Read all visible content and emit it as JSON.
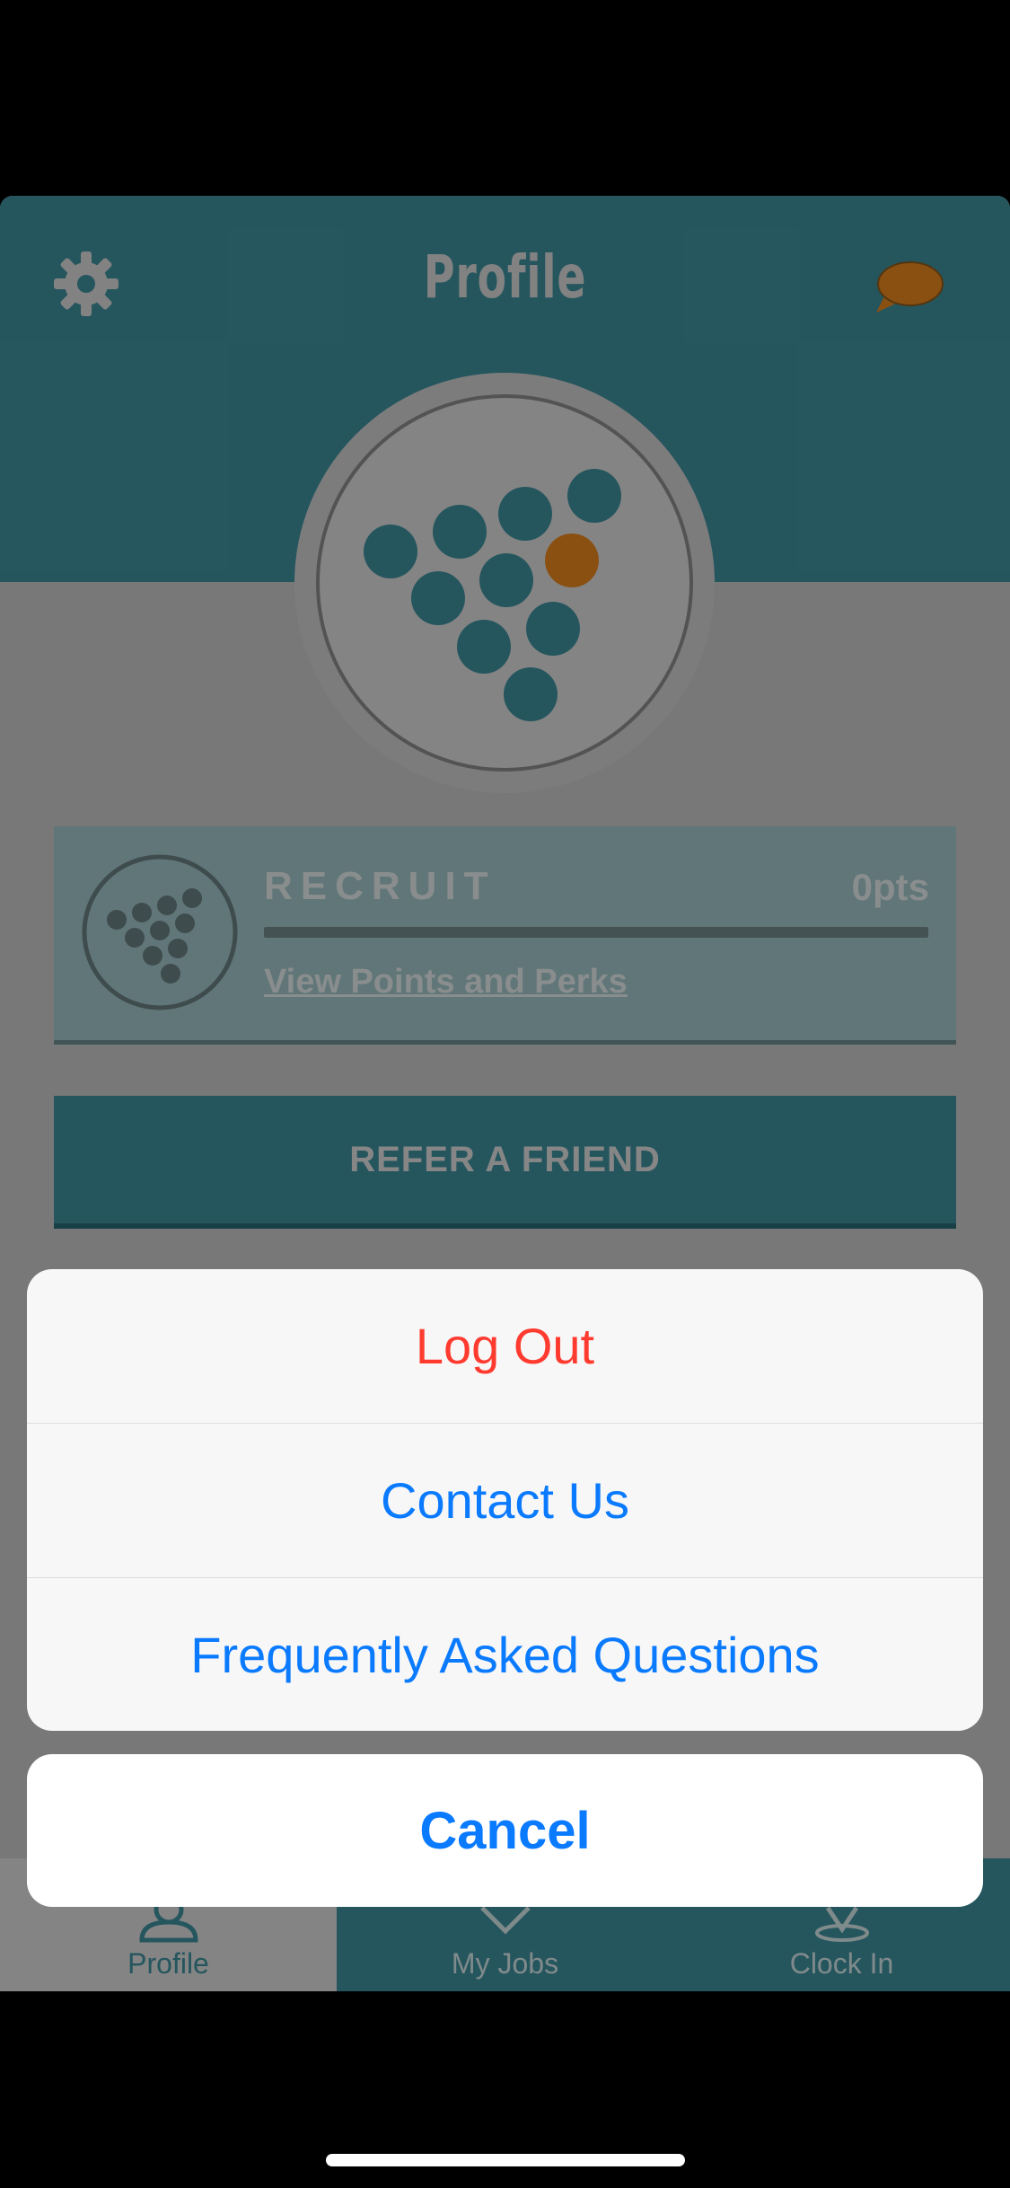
{
  "header": {
    "title": "Profile",
    "settings_icon": "gear-icon",
    "chat_icon": "speech-bubble-icon"
  },
  "rank": {
    "name": "RECRUIT",
    "points": "0pts",
    "progress": 0,
    "link": "View Points and Perks"
  },
  "refer_button": "REFER A FRIEND",
  "tabbar": {
    "tabs": [
      {
        "label": "Profile",
        "icon": "person-icon",
        "active": true
      },
      {
        "label": "My Jobs",
        "icon": "jobs-icon",
        "active": false
      },
      {
        "label": "Clock In",
        "icon": "location-pin-icon",
        "active": false
      }
    ]
  },
  "action_sheet": {
    "items": [
      {
        "label": "Log Out",
        "destructive": true
      },
      {
        "label": "Contact Us",
        "destructive": false
      },
      {
        "label": "Frequently Asked Questions",
        "destructive": false
      }
    ],
    "cancel": "Cancel"
  },
  "colors": {
    "teal": "#3f8f9d",
    "orange": "#e6861e",
    "ios_blue": "#0a7aff",
    "ios_red": "#ff3b30"
  }
}
